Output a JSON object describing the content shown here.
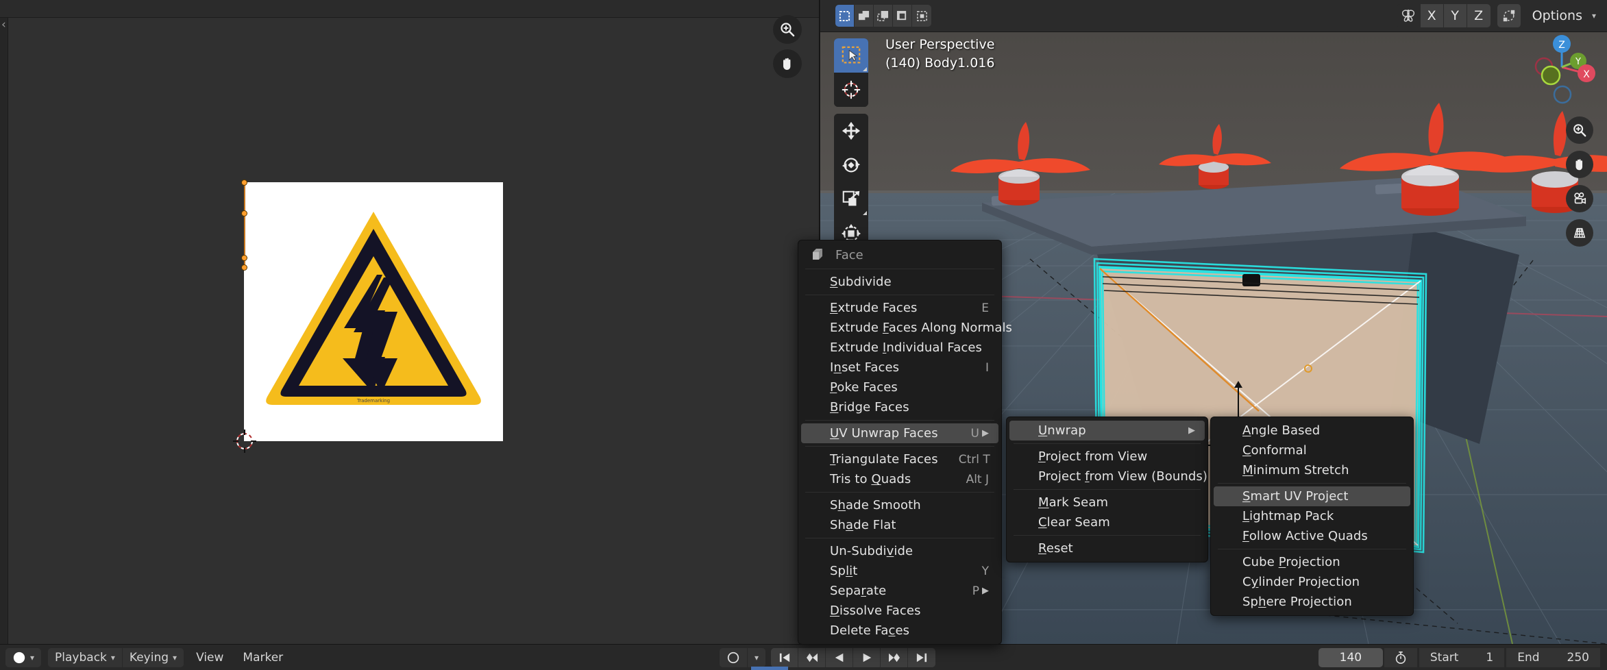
{
  "uv_editor": {
    "name": "uv-image-editor",
    "image_label": "warning-high-voltage-sign",
    "zoom_icon": "zoom-in-icon",
    "pan_icon": "hand-pan-icon",
    "cursor_icon": "2d-cursor-icon"
  },
  "viewport": {
    "perspective_label": "User Perspective",
    "object_label": "(140) Body1.016",
    "select_modes": [
      {
        "name": "tweak-select",
        "icon": "box-dashed-icon",
        "active": true
      },
      {
        "name": "box-select",
        "icon": "box-add-icon",
        "active": false
      },
      {
        "name": "circle-select",
        "icon": "box-subtract-icon",
        "active": false
      },
      {
        "name": "lasso-select",
        "icon": "box-intersect-icon",
        "active": false
      },
      {
        "name": "extend-select",
        "icon": "box-difference-icon",
        "active": false
      }
    ],
    "header_right": {
      "mirror_icon": "mirror-butterfly-icon",
      "axes": [
        "X",
        "Y",
        "Z"
      ],
      "proportional_icon": "proportional-editing-icon",
      "options_label": "Options",
      "options_caret": "chevron-down-icon"
    },
    "toolbar": [
      {
        "name": "tweak-tool",
        "icon": "cursor-arrow-select-icon",
        "active": true
      },
      {
        "name": "cursor-tool",
        "icon": "3d-cursor-icon",
        "active": false
      },
      {
        "name": "move-tool",
        "icon": "move-arrows-icon",
        "active": false
      },
      {
        "name": "rotate-tool",
        "icon": "rotate-circle-icon",
        "active": false
      },
      {
        "name": "scale-tool",
        "icon": "scale-corner-icon",
        "active": false
      },
      {
        "name": "transform-tool",
        "icon": "transform-gizmo-icon",
        "active": false
      }
    ],
    "gizmo_axes": [
      "Z",
      "Y",
      "X"
    ],
    "nav_buttons": [
      {
        "name": "zoom-view",
        "icon": "zoom-in-icon"
      },
      {
        "name": "pan-view",
        "icon": "hand-pan-icon"
      },
      {
        "name": "camera-view",
        "icon": "camera-icon"
      },
      {
        "name": "toggle-ortho",
        "icon": "grid-perspective-icon"
      }
    ]
  },
  "menus": {
    "face_menu": {
      "title": "Face",
      "title_icon": "face-cube-icon",
      "groups": [
        [
          {
            "label": "Subdivide",
            "accel": "S",
            "shortcut": "",
            "submenu": false,
            "highlighted": false
          }
        ],
        [
          {
            "label": "Extrude Faces",
            "accel": "E",
            "shortcut": "E",
            "submenu": false,
            "highlighted": false
          },
          {
            "label": "Extrude Faces Along Normals",
            "accel": "F",
            "shortcut": "",
            "submenu": false,
            "highlighted": false
          },
          {
            "label": "Extrude Individual Faces",
            "accel": "I",
            "shortcut": "",
            "submenu": false,
            "highlighted": false
          },
          {
            "label": "Inset Faces",
            "accel": "n",
            "shortcut": "I",
            "submenu": false,
            "highlighted": false
          },
          {
            "label": "Poke Faces",
            "accel": "P",
            "shortcut": "",
            "submenu": false,
            "highlighted": false
          },
          {
            "label": "Bridge Faces",
            "accel": "B",
            "shortcut": "",
            "submenu": false,
            "highlighted": false
          }
        ],
        [
          {
            "label": "UV Unwrap Faces",
            "accel": "U",
            "shortcut": "U",
            "submenu": true,
            "highlighted": true
          }
        ],
        [
          {
            "label": "Triangulate Faces",
            "accel": "T",
            "shortcut": "Ctrl T",
            "submenu": false,
            "highlighted": false
          },
          {
            "label": "Tris to Quads",
            "accel": "Q",
            "shortcut": "Alt J",
            "submenu": false,
            "highlighted": false
          }
        ],
        [
          {
            "label": "Shade Smooth",
            "accel": "h",
            "shortcut": "",
            "submenu": false,
            "highlighted": false
          },
          {
            "label": "Shade Flat",
            "accel": "a",
            "shortcut": "",
            "submenu": false,
            "highlighted": false
          }
        ],
        [
          {
            "label": "Un-Subdivide",
            "accel": "v",
            "shortcut": "",
            "submenu": false,
            "highlighted": false
          },
          {
            "label": "Split",
            "accel": "li",
            "shortcut": "Y",
            "submenu": false,
            "highlighted": false
          },
          {
            "label": "Separate",
            "accel": "r",
            "shortcut": "P",
            "submenu": true,
            "highlighted": false
          },
          {
            "label": "Dissolve Faces",
            "accel": "D",
            "shortcut": "",
            "submenu": false,
            "highlighted": false
          },
          {
            "label": "Delete Faces",
            "accel": "c",
            "shortcut": "",
            "submenu": false,
            "highlighted": false
          }
        ]
      ]
    },
    "uv_submenu": {
      "groups": [
        [
          {
            "label": "Unwrap",
            "accel": "U",
            "shortcut": "",
            "submenu": true,
            "highlighted": true
          }
        ],
        [
          {
            "label": "Project from View",
            "accel": "P",
            "shortcut": "",
            "submenu": false,
            "highlighted": false
          },
          {
            "label": "Project from View (Bounds)",
            "accel": "f",
            "shortcut": "",
            "submenu": false,
            "highlighted": false
          }
        ],
        [
          {
            "label": "Mark Seam",
            "accel": "M",
            "shortcut": "",
            "submenu": false,
            "highlighted": false
          },
          {
            "label": "Clear Seam",
            "accel": "C",
            "shortcut": "",
            "submenu": false,
            "highlighted": false
          }
        ],
        [
          {
            "label": "Reset",
            "accel": "R",
            "shortcut": "",
            "submenu": false,
            "highlighted": false
          }
        ]
      ]
    },
    "unwrap_submenu": {
      "groups": [
        [
          {
            "label": "Angle Based",
            "accel": "A",
            "shortcut": "",
            "submenu": false,
            "highlighted": false
          },
          {
            "label": "Conformal",
            "accel": "C",
            "shortcut": "",
            "submenu": false,
            "highlighted": false
          },
          {
            "label": "Minimum Stretch",
            "accel": "M",
            "shortcut": "",
            "submenu": false,
            "highlighted": false
          }
        ],
        [
          {
            "label": "Smart UV Project",
            "accel": "S",
            "shortcut": "",
            "submenu": false,
            "highlighted": true
          },
          {
            "label": "Lightmap Pack",
            "accel": "L",
            "shortcut": "",
            "submenu": false,
            "highlighted": false
          },
          {
            "label": "Follow Active Quads",
            "accel": "F",
            "shortcut": "",
            "submenu": false,
            "highlighted": false
          }
        ],
        [
          {
            "label": "Cube Projection",
            "accel": "P",
            "shortcut": "",
            "submenu": false,
            "highlighted": false
          },
          {
            "label": "Cylinder Projection",
            "accel": "y",
            "shortcut": "",
            "submenu": false,
            "highlighted": false
          },
          {
            "label": "Sphere Projection",
            "accel": "h",
            "shortcut": "",
            "submenu": false,
            "highlighted": false
          }
        ]
      ]
    }
  },
  "timeline": {
    "editor_icon": "timeline-editor-icon",
    "editor_caret": "chevron-down-icon",
    "menus": [
      {
        "name": "playback-menu",
        "label": "Playback",
        "caret": true
      },
      {
        "name": "keying-menu",
        "label": "Keying",
        "caret": true
      },
      {
        "name": "view-menu",
        "label": "View",
        "caret": false
      },
      {
        "name": "marker-menu",
        "label": "Marker",
        "caret": false
      }
    ],
    "record_icon": "record-circle-icon",
    "record_caret": "chevron-down-icon",
    "transport": [
      {
        "name": "jump-to-start-button",
        "icon": "skip-start-icon"
      },
      {
        "name": "prev-keyframe-button",
        "icon": "prev-keyframe-icon"
      },
      {
        "name": "play-reverse-button",
        "icon": "play-reverse-icon"
      },
      {
        "name": "play-button",
        "icon": "play-icon"
      },
      {
        "name": "next-keyframe-button",
        "icon": "next-keyframe-icon"
      },
      {
        "name": "jump-to-end-button",
        "icon": "skip-end-icon"
      }
    ],
    "current_frame": "140",
    "stopwatch_icon": "stopwatch-icon",
    "start_label": "Start",
    "start_value": "1",
    "end_label": "End",
    "end_value": "250"
  },
  "colors": {
    "accent_blue": "#4772b3",
    "menu_bg": "#1d1d1d",
    "menu_highlight": "#4a4a4a",
    "uv_vertex": "#ff9f2e",
    "axis_x": "#e04a5f",
    "axis_y": "#8bc34a",
    "axis_z": "#3b8fd9",
    "selection_cyan": "#29e2e2",
    "propeller_red": "#e8432a",
    "sign_yellow": "#f5bc1c"
  }
}
